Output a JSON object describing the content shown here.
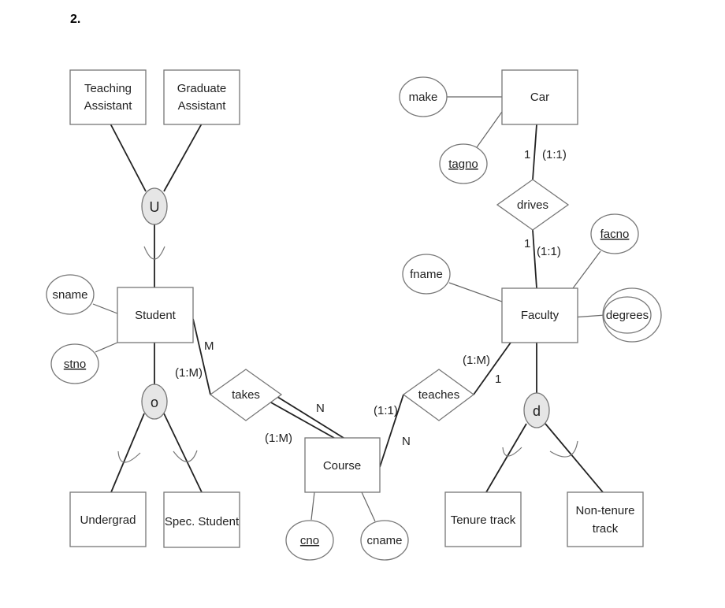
{
  "question_number": "2.",
  "entities": {
    "teaching_assistant": [
      "Teaching",
      "Assistant"
    ],
    "graduate_assistant": [
      "Graduate",
      "Assistant"
    ],
    "student": "Student",
    "undergrad": "Undergrad",
    "spec_student": "Spec. Student",
    "course": "Course",
    "car": "Car",
    "faculty": "Faculty",
    "tenure_track": "Tenure track",
    "non_tenure_track": [
      "Non-tenure",
      "track"
    ]
  },
  "attributes": {
    "sname": "sname",
    "stno": "stno",
    "cno": "cno",
    "cname": "cname",
    "make": "make",
    "tagno": "tagno",
    "fname": "fname",
    "facno": "facno",
    "degrees": "degrees"
  },
  "relationships": {
    "takes": "takes",
    "teaches": "teaches",
    "drives": "drives"
  },
  "specializations": {
    "union": "U",
    "overlap": "o",
    "disjoint": "d"
  },
  "cardinalities": {
    "student_takes": "M",
    "student_takes_ratio": "(1:M)",
    "takes_course": "N",
    "takes_course_ratio": "(1:M)",
    "teaches_course_ratio": "(1:1)",
    "teaches_course": "N",
    "faculty_teaches_ratio": "(1:M)",
    "faculty_teaches": "1",
    "car_drives": "1",
    "car_drives_ratio": "(1:1)",
    "drives_faculty": "1",
    "drives_faculty_ratio": "(1:1)"
  }
}
